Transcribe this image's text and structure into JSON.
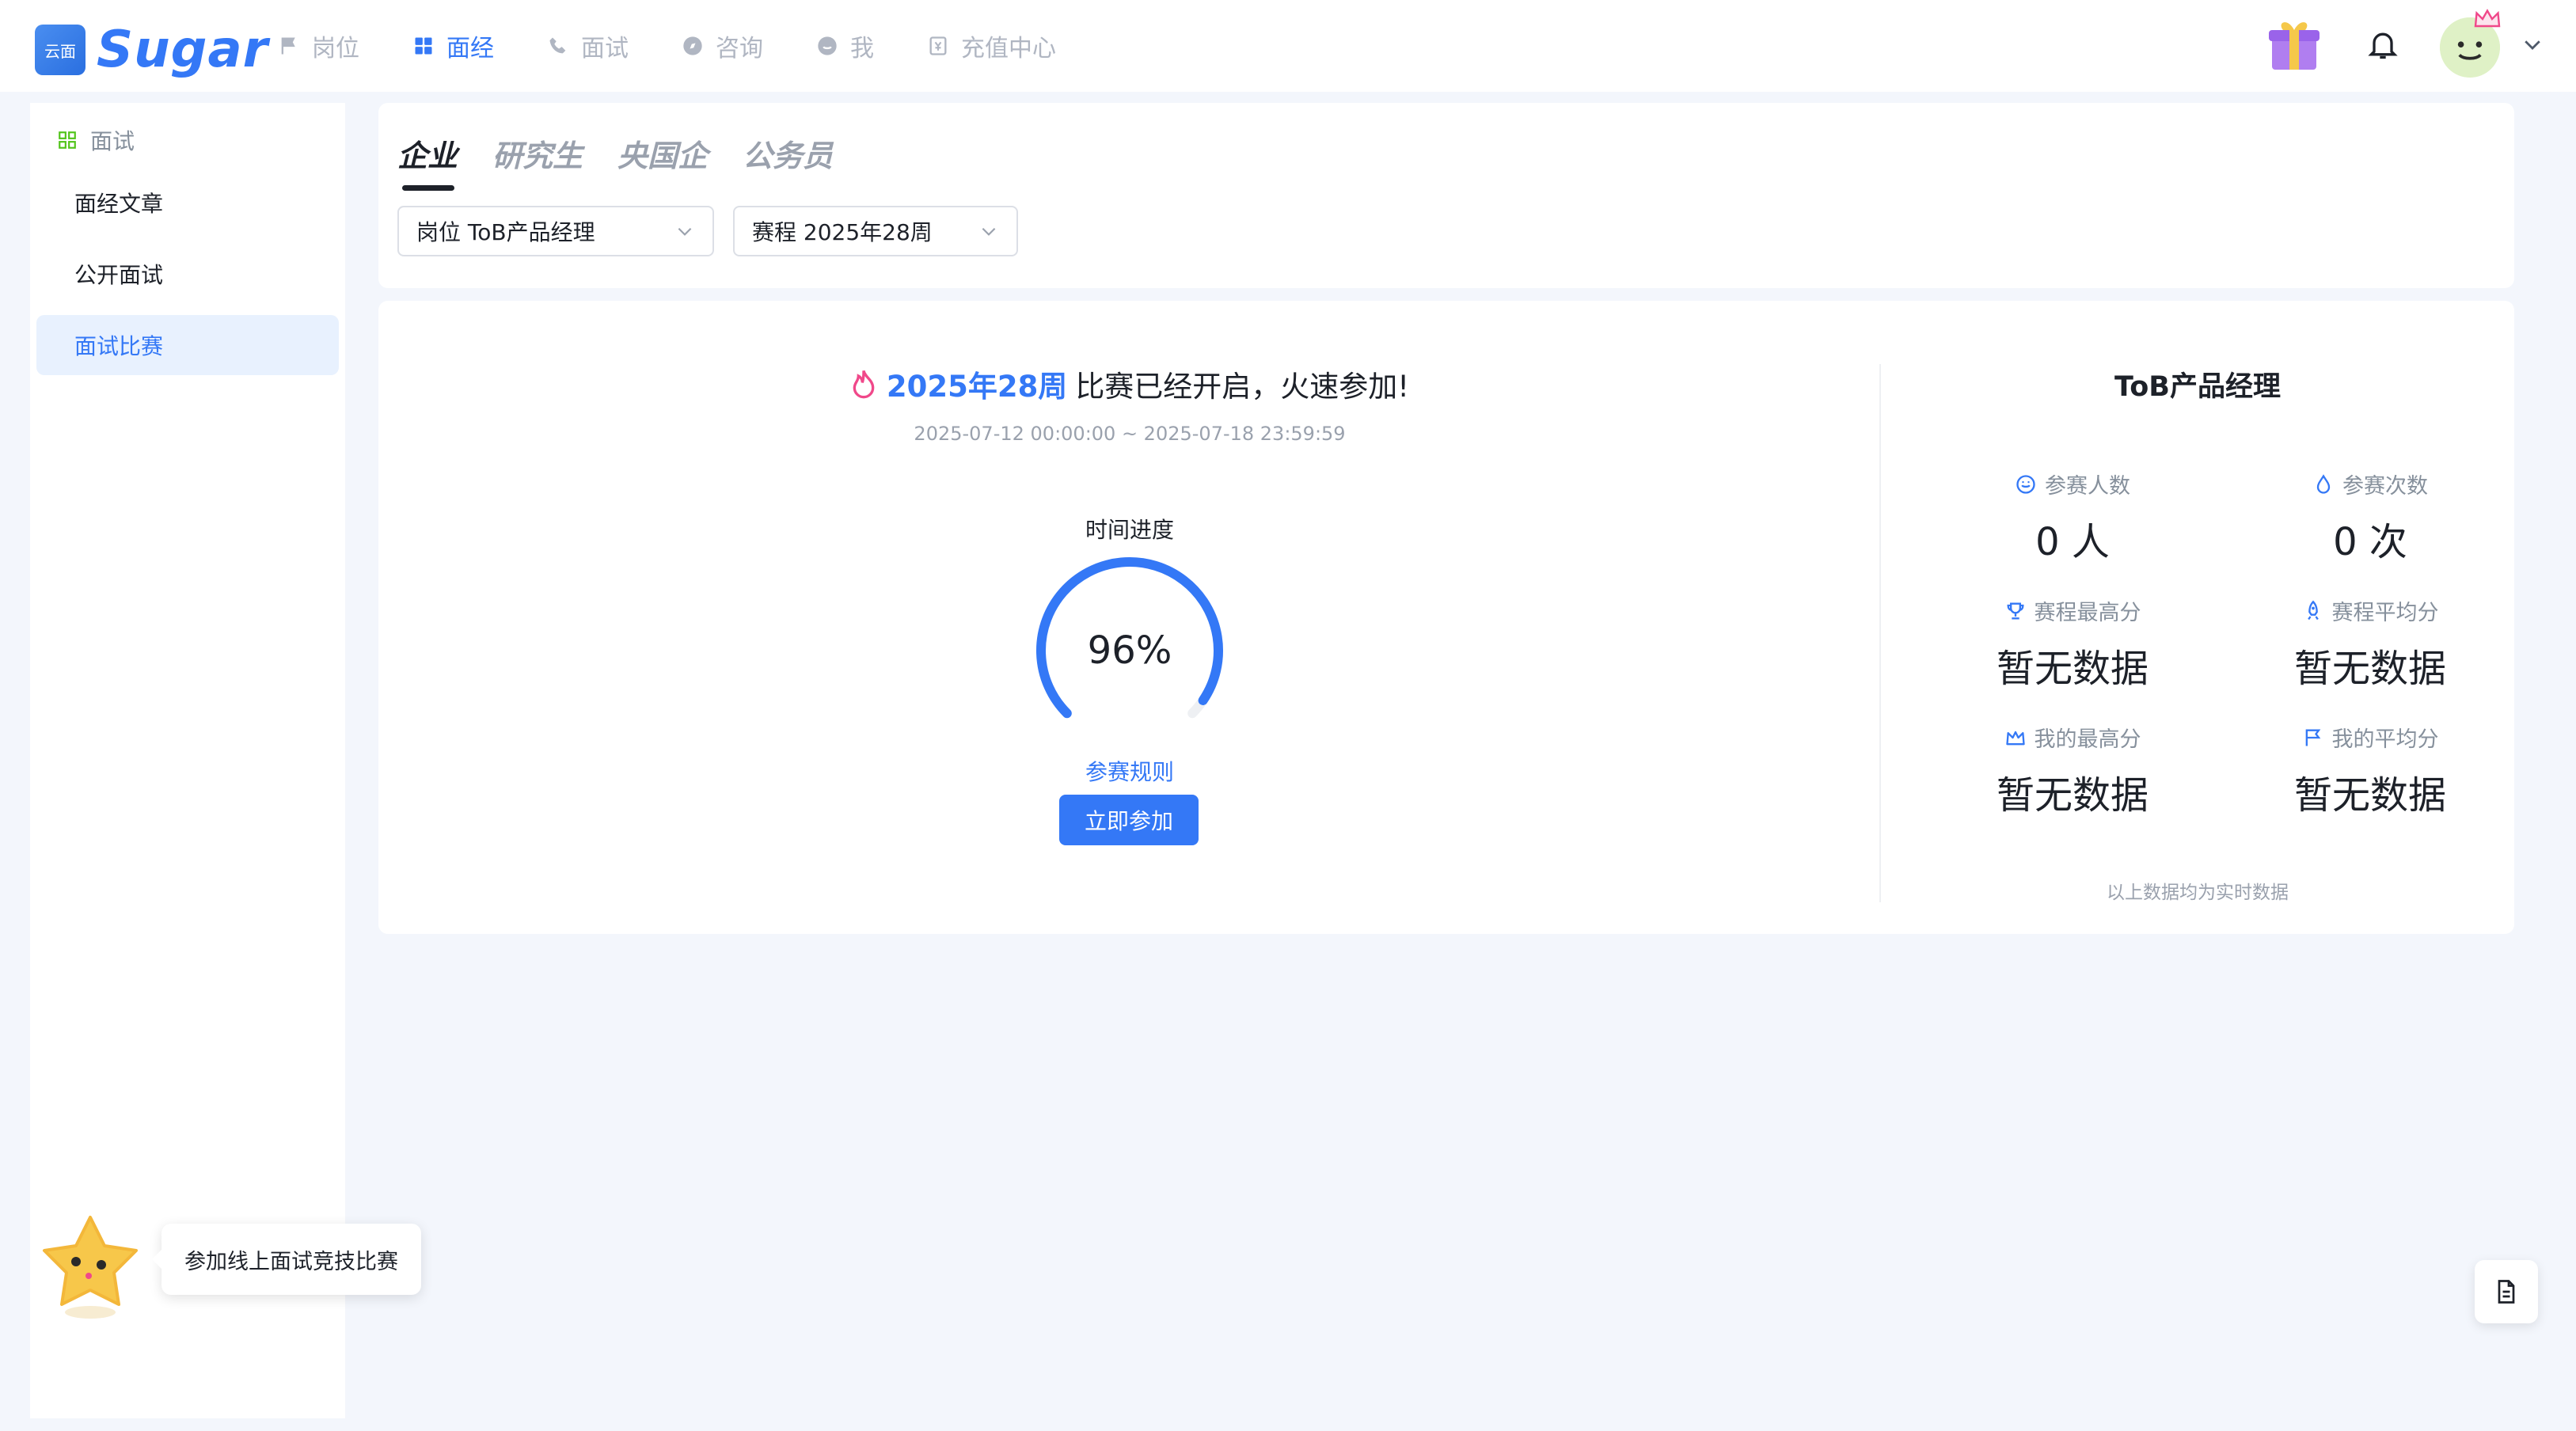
{
  "app": {
    "logo_badge": "云面",
    "logo_text": "Sugar"
  },
  "nav": {
    "items": [
      {
        "label": "岗位",
        "icon": "flag-icon",
        "active": false
      },
      {
        "label": "面经",
        "icon": "grid-icon",
        "active": true
      },
      {
        "label": "面试",
        "icon": "phone-icon",
        "active": false
      },
      {
        "label": "咨询",
        "icon": "compass-icon",
        "active": false
      },
      {
        "label": "我",
        "icon": "smile-icon",
        "active": false
      },
      {
        "label": "充值中心",
        "icon": "wallet-icon",
        "active": false
      }
    ]
  },
  "sidebar": {
    "group_label": "面试",
    "items": [
      {
        "label": "面经文章",
        "active": false
      },
      {
        "label": "公开面试",
        "active": false
      },
      {
        "label": "面试比赛",
        "active": true
      }
    ]
  },
  "mascot": {
    "tooltip": "参加线上面试竞技比赛"
  },
  "filters": {
    "tabs": [
      {
        "label": "企业",
        "active": true
      },
      {
        "label": "研究生",
        "active": false
      },
      {
        "label": "央国企",
        "active": false
      },
      {
        "label": "公务员",
        "active": false
      }
    ],
    "position_select": "岗位 ToB产品经理",
    "round_select": "赛程 2025年28周"
  },
  "contest": {
    "week": "2025年28周",
    "headline_rest": "比赛已经开启，火速参加!",
    "dates": "2025-07-12 00:00:00 ~ 2025-07-18 23:59:59",
    "progress_label": "时间进度",
    "progress_percent": 96,
    "progress_text": "96%",
    "rules_link": "参赛规则",
    "join_button": "立即参加"
  },
  "stats": {
    "title": "ToB产品经理",
    "items": [
      {
        "label": "参赛人数",
        "value": "0 人",
        "icon": "smile-icon"
      },
      {
        "label": "参赛次数",
        "value": "0 次",
        "icon": "drop-icon"
      },
      {
        "label": "赛程最高分",
        "value": "暂无数据",
        "icon": "trophy-icon"
      },
      {
        "label": "赛程平均分",
        "value": "暂无数据",
        "icon": "rocket-icon"
      },
      {
        "label": "我的最高分",
        "value": "暂无数据",
        "icon": "crown-icon"
      },
      {
        "label": "我的平均分",
        "value": "暂无数据",
        "icon": "flag-icon"
      }
    ],
    "note": "以上数据均为实时数据"
  },
  "colors": {
    "accent": "#3478f6",
    "background": "#f3f6fc",
    "fire": "#f0488a"
  }
}
